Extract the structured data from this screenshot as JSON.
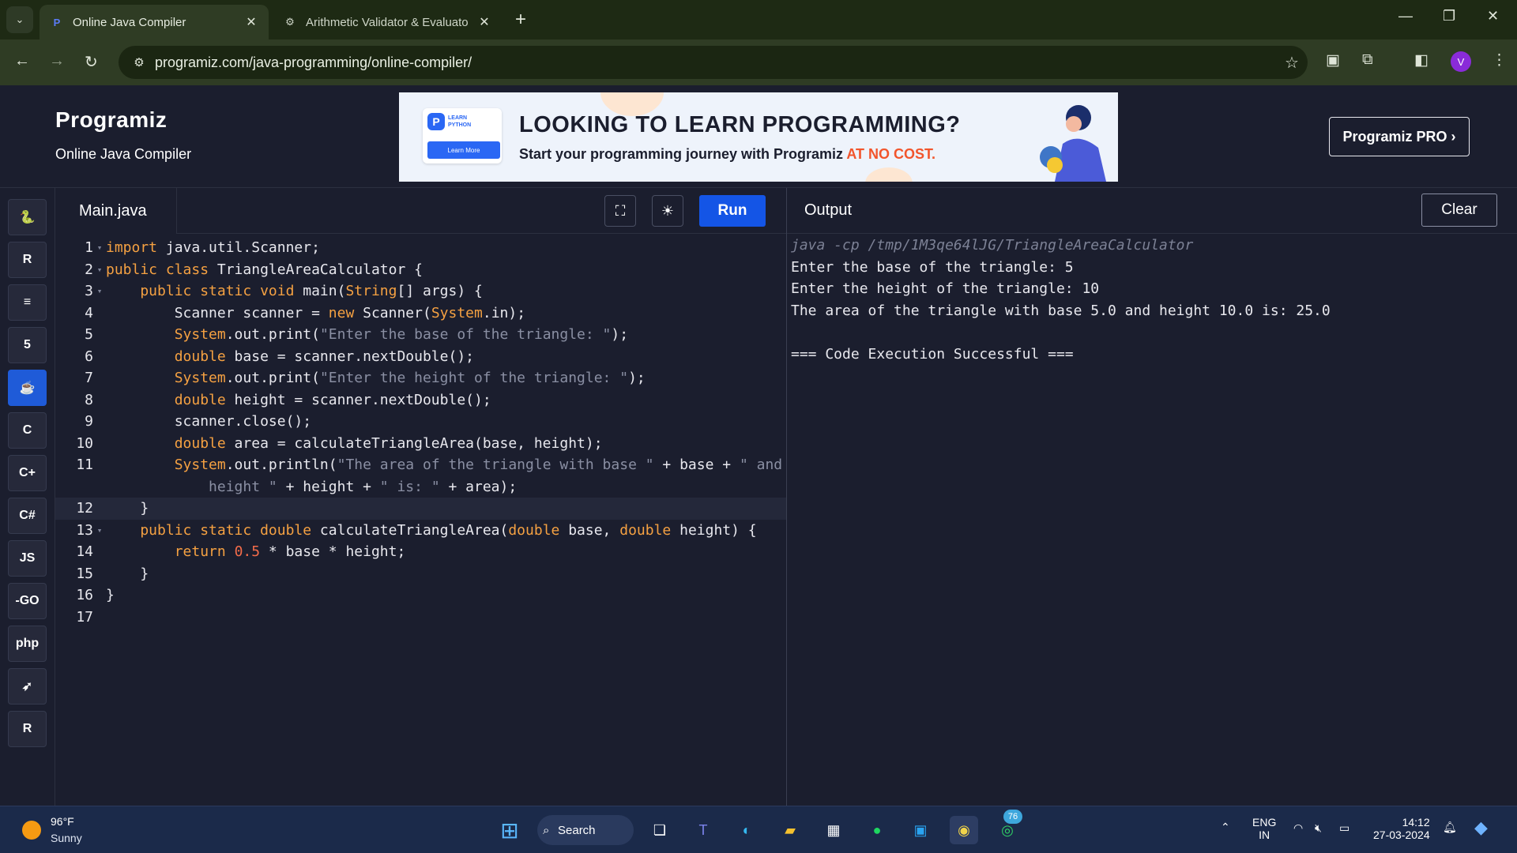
{
  "browser": {
    "tabs": [
      {
        "title": "Online Java Compiler",
        "active": true
      },
      {
        "title": "Arithmetic Validator & Evaluato",
        "active": false
      }
    ],
    "url": "programiz.com/java-programming/online-compiler/",
    "profile_initial": "V"
  },
  "header": {
    "logo": "Programiz",
    "subtitle": "Online Java Compiler",
    "pro_button": "Programiz PRO ›",
    "banner": {
      "badge_line1": "LEARN",
      "badge_line2": "PYTHON",
      "learn_more": "Learn More",
      "headline": "LOOKING TO LEARN PROGRAMMING?",
      "subline": "Start your programming journey with Programiz ",
      "highlight": "AT NO COST."
    }
  },
  "sidebar": {
    "languages": [
      {
        "name": "python",
        "glyph": "🐍",
        "active": false
      },
      {
        "name": "r",
        "glyph": "R",
        "active": false
      },
      {
        "name": "sql",
        "glyph": "≡",
        "active": false
      },
      {
        "name": "html",
        "glyph": "5",
        "active": false
      },
      {
        "name": "java",
        "glyph": "☕",
        "active": true
      },
      {
        "name": "c",
        "glyph": "C",
        "active": false
      },
      {
        "name": "cpp",
        "glyph": "C+",
        "active": false
      },
      {
        "name": "csharp",
        "glyph": "C#",
        "active": false
      },
      {
        "name": "javascript",
        "glyph": "JS",
        "active": false
      },
      {
        "name": "go",
        "glyph": "-GO",
        "active": false
      },
      {
        "name": "php",
        "glyph": "php",
        "active": false
      },
      {
        "name": "swift",
        "glyph": "➶",
        "active": false
      },
      {
        "name": "rust",
        "glyph": "R",
        "active": false
      }
    ]
  },
  "editor": {
    "filename": "Main.java",
    "run_label": "Run",
    "lines": [
      {
        "num": "1",
        "fold": true,
        "current": false,
        "tokens": [
          {
            "t": "import",
            "c": "kw"
          },
          {
            "t": " java.util.Scanner;",
            "c": "tx"
          }
        ]
      },
      {
        "num": "2",
        "fold": true,
        "current": false,
        "tokens": [
          {
            "t": "public class",
            "c": "kw"
          },
          {
            "t": " TriangleAreaCalculator {",
            "c": "tx"
          }
        ]
      },
      {
        "num": "3",
        "fold": true,
        "current": false,
        "tokens": [
          {
            "t": "    public static void",
            "c": "kw"
          },
          {
            "t": " main(",
            "c": "tx"
          },
          {
            "t": "String",
            "c": "kw"
          },
          {
            "t": "[] args) {",
            "c": "tx"
          }
        ]
      },
      {
        "num": "4",
        "fold": false,
        "current": false,
        "tokens": [
          {
            "t": "        Scanner scanner = ",
            "c": "tx"
          },
          {
            "t": "new",
            "c": "kw"
          },
          {
            "t": " Scanner(",
            "c": "tx"
          },
          {
            "t": "System",
            "c": "kw"
          },
          {
            "t": ".in);",
            "c": "tx"
          }
        ]
      },
      {
        "num": "5",
        "fold": false,
        "current": false,
        "tokens": [
          {
            "t": "        System",
            "c": "kw"
          },
          {
            "t": ".out.print(",
            "c": "tx"
          },
          {
            "t": "\"Enter the base of the triangle: \"",
            "c": "str"
          },
          {
            "t": ");",
            "c": "tx"
          }
        ]
      },
      {
        "num": "6",
        "fold": false,
        "current": false,
        "tokens": [
          {
            "t": "        double",
            "c": "kw"
          },
          {
            "t": " base = scanner.nextDouble();",
            "c": "tx"
          }
        ]
      },
      {
        "num": "7",
        "fold": false,
        "current": false,
        "tokens": [
          {
            "t": "        System",
            "c": "kw"
          },
          {
            "t": ".out.print(",
            "c": "tx"
          },
          {
            "t": "\"Enter the height of the triangle: \"",
            "c": "str"
          },
          {
            "t": ");",
            "c": "tx"
          }
        ]
      },
      {
        "num": "8",
        "fold": false,
        "current": false,
        "tokens": [
          {
            "t": "        double",
            "c": "kw"
          },
          {
            "t": " height = scanner.nextDouble();",
            "c": "tx"
          }
        ]
      },
      {
        "num": "9",
        "fold": false,
        "current": false,
        "tokens": [
          {
            "t": "        scanner.close();",
            "c": "tx"
          }
        ]
      },
      {
        "num": "10",
        "fold": false,
        "current": false,
        "tokens": [
          {
            "t": "        double",
            "c": "kw"
          },
          {
            "t": " area = calculateTriangleArea(base, height);",
            "c": "tx"
          }
        ]
      },
      {
        "num": "11",
        "fold": false,
        "current": false,
        "tokens": [
          {
            "t": "        System",
            "c": "kw"
          },
          {
            "t": ".out.println(",
            "c": "tx"
          },
          {
            "t": "\"The area of the triangle with base \"",
            "c": "str"
          },
          {
            "t": " + base + ",
            "c": "tx"
          },
          {
            "t": "\" and",
            "c": "str"
          }
        ]
      },
      {
        "num": "",
        "fold": false,
        "current": false,
        "tokens": [
          {
            "t": "            height \"",
            "c": "str"
          },
          {
            "t": " + height + ",
            "c": "tx"
          },
          {
            "t": "\" is: \"",
            "c": "str"
          },
          {
            "t": " + area);",
            "c": "tx"
          }
        ]
      },
      {
        "num": "12",
        "fold": false,
        "current": true,
        "tokens": [
          {
            "t": "    }",
            "c": "tx"
          }
        ]
      },
      {
        "num": "13",
        "fold": true,
        "current": false,
        "tokens": [
          {
            "t": "    public static double",
            "c": "kw"
          },
          {
            "t": " calculateTriangleArea(",
            "c": "tx"
          },
          {
            "t": "double",
            "c": "kw"
          },
          {
            "t": " base, ",
            "c": "tx"
          },
          {
            "t": "double",
            "c": "kw"
          },
          {
            "t": " height) {",
            "c": "tx"
          }
        ]
      },
      {
        "num": "14",
        "fold": false,
        "current": false,
        "tokens": [
          {
            "t": "        return",
            "c": "kw"
          },
          {
            "t": " ",
            "c": "tx"
          },
          {
            "t": "0.5",
            "c": "num"
          },
          {
            "t": " * base * height;",
            "c": "tx"
          }
        ]
      },
      {
        "num": "15",
        "fold": false,
        "current": false,
        "tokens": [
          {
            "t": "    }",
            "c": "tx"
          }
        ]
      },
      {
        "num": "16",
        "fold": false,
        "current": false,
        "tokens": [
          {
            "t": "}",
            "c": "tx"
          }
        ]
      },
      {
        "num": "17",
        "fold": false,
        "current": false,
        "tokens": [
          {
            "t": "",
            "c": "tx"
          }
        ]
      }
    ]
  },
  "output": {
    "title": "Output",
    "clear_label": "Clear",
    "lines": [
      {
        "text": "java -cp /tmp/1M3qe64lJG/TriangleAreaCalculator",
        "cmd": true
      },
      {
        "text": "Enter the base of the triangle: 5",
        "cmd": false
      },
      {
        "text": "Enter the height of the triangle: 10",
        "cmd": false
      },
      {
        "text": "The area of the triangle with base 5.0 and height 10.0 is: 25.0",
        "cmd": false
      },
      {
        "text": "",
        "cmd": false
      },
      {
        "text": "=== Code Execution Successful ===",
        "cmd": false
      }
    ]
  },
  "taskbar": {
    "temperature": "96°F",
    "condition": "Sunny",
    "search_label": "Search",
    "whatsapp_badge": "76",
    "lang_top": "ENG",
    "lang_bottom": "IN",
    "time": "14:12",
    "date": "27-03-2024"
  },
  "colors": {
    "keyword": "#f5a142",
    "string": "#8a8fa3",
    "number": "#f36c4a",
    "text": "#e8e8ee",
    "run_button": "#1455e6"
  }
}
